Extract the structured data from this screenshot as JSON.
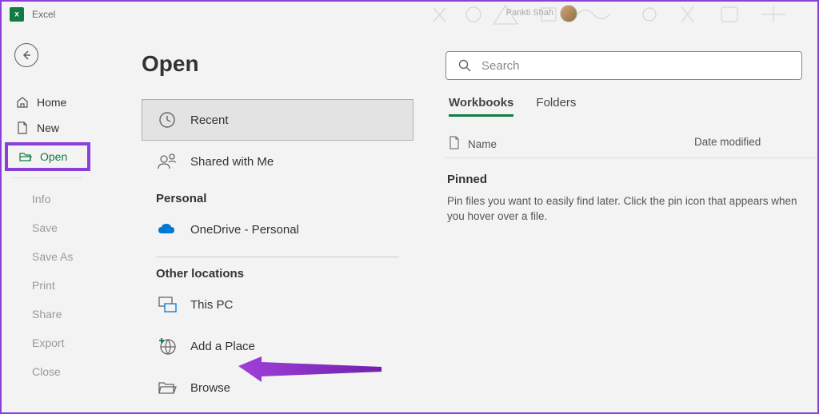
{
  "app": {
    "title": "Excel",
    "username": "Pankti Shah"
  },
  "nav": {
    "home": "Home",
    "new": "New",
    "open": "Open",
    "info": "Info",
    "save": "Save",
    "saveas": "Save As",
    "print": "Print",
    "share": "Share",
    "export": "Export",
    "close": "Close"
  },
  "page": {
    "title": "Open",
    "sections": {
      "personal": "Personal",
      "other": "Other locations"
    },
    "locations": {
      "recent": "Recent",
      "shared": "Shared with Me",
      "onedrive": "OneDrive - Personal",
      "thispc": "This PC",
      "addplace": "Add a Place",
      "browse": "Browse"
    },
    "search": {
      "placeholder": "Search"
    },
    "tabs": {
      "workbooks": "Workbooks",
      "folders": "Folders"
    },
    "table": {
      "name": "Name",
      "date": "Date modified"
    },
    "pinned": {
      "label": "Pinned",
      "hint": "Pin files you want to easily find later. Click the pin icon that appears when you hover over a file."
    }
  }
}
